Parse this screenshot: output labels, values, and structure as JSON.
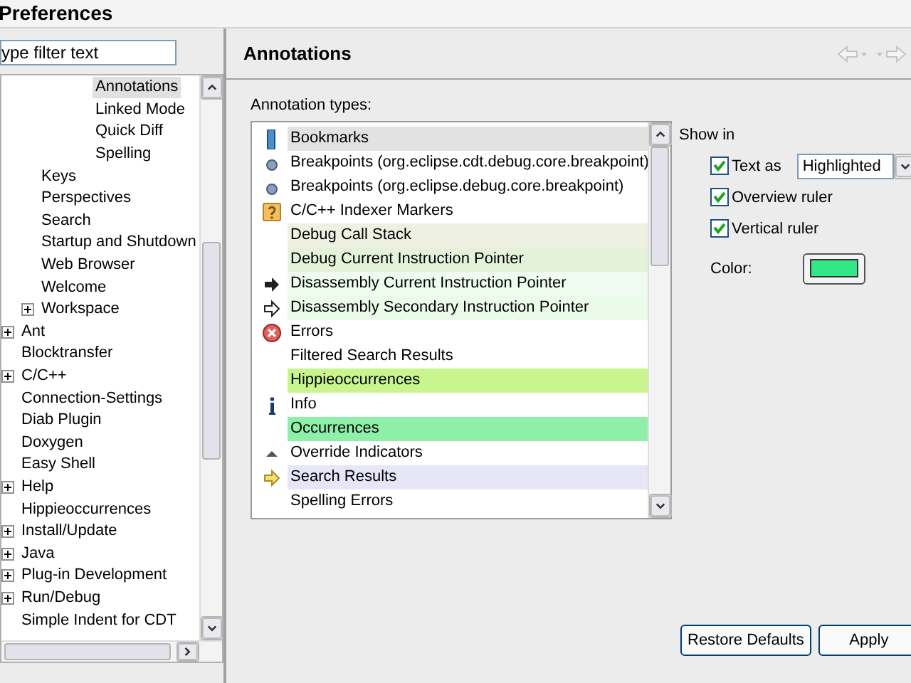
{
  "window": {
    "title": "Preferences"
  },
  "filter": {
    "value": "ype filter text"
  },
  "tree": [
    {
      "children": [
        {
          "children": [
            {
              "children": [
                {
                  "label": "Annotations",
                  "selected": true,
                  "expandable": false
                },
                {
                  "label": "Linked Mode",
                  "selected": false,
                  "expandable": false
                },
                {
                  "label": "Quick Diff",
                  "selected": false,
                  "expandable": false
                },
                {
                  "label": "Spelling",
                  "selected": false,
                  "expandable": false
                }
              ]
            }
          ]
        },
        {
          "label": "Keys",
          "selected": false,
          "expandable": false
        },
        {
          "label": "Perspectives",
          "selected": false,
          "expandable": false
        },
        {
          "label": "Search",
          "selected": false,
          "expandable": false
        },
        {
          "label": "Startup and Shutdown",
          "selected": false,
          "expandable": false
        },
        {
          "label": "Web Browser",
          "selected": false,
          "expandable": false
        },
        {
          "label": "Welcome",
          "selected": false,
          "expandable": false
        },
        {
          "label": "Workspace",
          "selected": false,
          "expandable": true
        }
      ]
    },
    {
      "label": "Ant",
      "selected": false,
      "expandable": true
    },
    {
      "label": "Blocktransfer",
      "selected": false,
      "expandable": false
    },
    {
      "label": "C/C++",
      "selected": false,
      "expandable": true
    },
    {
      "label": "Connection-Settings",
      "selected": false,
      "expandable": false
    },
    {
      "label": "Diab Plugin",
      "selected": false,
      "expandable": false
    },
    {
      "label": "Doxygen",
      "selected": false,
      "expandable": false
    },
    {
      "label": "Easy Shell",
      "selected": false,
      "expandable": false
    },
    {
      "label": "Help",
      "selected": false,
      "expandable": true
    },
    {
      "label": "Hippieoccurrences",
      "selected": false,
      "expandable": false
    },
    {
      "label": "Install/Update",
      "selected": false,
      "expandable": true
    },
    {
      "label": "Java",
      "selected": false,
      "expandable": true
    },
    {
      "label": "Plug-in Development",
      "selected": false,
      "expandable": true
    },
    {
      "label": "Run/Debug",
      "selected": false,
      "expandable": true
    },
    {
      "label": "Simple Indent for CDT",
      "selected": false,
      "expandable": false
    }
  ],
  "page": {
    "title": "Annotations",
    "list_label": "Annotation types:"
  },
  "annotation_types": [
    {
      "label": "Bookmarks",
      "kind": "bookmark",
      "selected": true
    },
    {
      "label": "Breakpoints (org.eclipse.cdt.debug.core.breakpoint)",
      "kind": "breakpoint",
      "selected": false
    },
    {
      "label": "Breakpoints (org.eclipse.debug.core.breakpoint)",
      "kind": "breakpoint",
      "selected": false
    },
    {
      "label": "C/C++ Indexer Markers",
      "kind": "question",
      "selected": false
    },
    {
      "label": "Debug Call Stack",
      "kind": "plain",
      "selected": false,
      "color": "#eef1e2"
    },
    {
      "label": "Debug Current Instruction Pointer",
      "kind": "plain",
      "selected": false,
      "color": "#e5f2da"
    },
    {
      "label": "Disassembly Current Instruction Pointer",
      "kind": "solidarrow",
      "selected": false,
      "color": "#effbef"
    },
    {
      "label": "Disassembly Secondary Instruction Pointer",
      "kind": "outlinearrow",
      "selected": false,
      "color": "#ebfbea"
    },
    {
      "label": "Errors",
      "kind": "error",
      "selected": false
    },
    {
      "label": "Filtered Search Results",
      "kind": "plain",
      "selected": false
    },
    {
      "label": "Hippieoccurrences",
      "kind": "plain",
      "selected": false,
      "color": "#c9f58e"
    },
    {
      "label": "Info",
      "kind": "info",
      "selected": false
    },
    {
      "label": "Occurrences",
      "kind": "plain",
      "selected": false,
      "color": "#8ef0a8"
    },
    {
      "label": "Override Indicators",
      "kind": "triangle",
      "selected": false
    },
    {
      "label": "Search Results",
      "kind": "searcharrow",
      "selected": false,
      "color": "#e6e6f6"
    },
    {
      "label": "Spelling Errors",
      "kind": "plain",
      "selected": false
    }
  ],
  "show_in": {
    "label": "Show in",
    "options": [
      {
        "label": "Text as",
        "checked": true,
        "kind": "select",
        "value": "Highlighted"
      },
      {
        "label": "Overview ruler",
        "checked": true,
        "kind": "plain"
      },
      {
        "label": "Vertical ruler",
        "checked": true,
        "kind": "plain"
      }
    ],
    "color_label": "Color:",
    "color": "#33e688"
  },
  "buttons": [
    "Restore Defaults",
    "Apply"
  ]
}
